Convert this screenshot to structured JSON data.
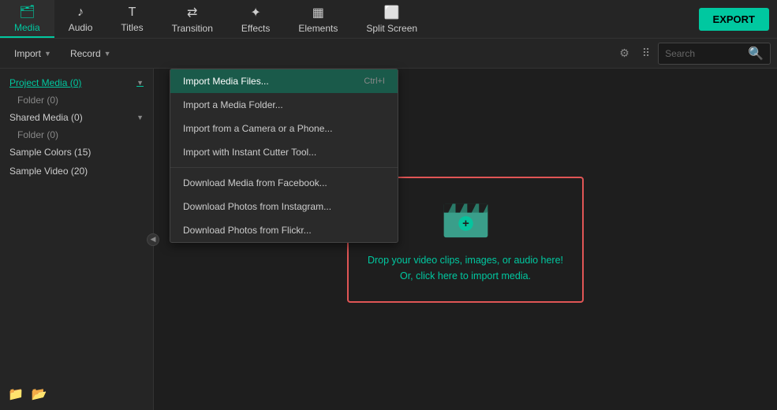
{
  "nav": {
    "items": [
      {
        "id": "media",
        "label": "Media",
        "icon": "🗂",
        "active": true
      },
      {
        "id": "audio",
        "label": "Audio",
        "icon": "♪"
      },
      {
        "id": "titles",
        "label": "Titles",
        "icon": "T"
      },
      {
        "id": "transition",
        "label": "Transition",
        "icon": "⇄"
      },
      {
        "id": "effects",
        "label": "Effects",
        "icon": "✦"
      },
      {
        "id": "elements",
        "label": "Elements",
        "icon": "▦"
      },
      {
        "id": "splitscreen",
        "label": "Split Screen",
        "icon": "⬜"
      }
    ],
    "export_label": "EXPORT"
  },
  "secondary_bar": {
    "import_label": "Import",
    "record_label": "Record",
    "search_placeholder": "Search"
  },
  "sidebar": {
    "items": [
      {
        "id": "project-media",
        "label": "Project Media (0)",
        "active": true
      },
      {
        "id": "folder-0",
        "label": "Folder (0)",
        "sub": true
      },
      {
        "id": "shared-media",
        "label": "Shared Media (0)"
      },
      {
        "id": "folder-0b",
        "label": "Folder (0)",
        "sub": true
      },
      {
        "id": "sample-colors",
        "label": "Sample Colors (15)"
      },
      {
        "id": "sample-video",
        "label": "Sample Video (20)"
      }
    ],
    "bottom_icons": [
      "new-folder-icon",
      "new-smart-folder-icon"
    ]
  },
  "dropdown": {
    "items": [
      {
        "id": "import-files",
        "label": "Import Media Files...",
        "shortcut": "Ctrl+I",
        "highlighted": true
      },
      {
        "id": "import-folder",
        "label": "Import a Media Folder..."
      },
      {
        "id": "import-camera",
        "label": "Import from a Camera or a Phone..."
      },
      {
        "id": "import-cutter",
        "label": "Import with Instant Cutter Tool..."
      },
      {
        "id": "separator1",
        "separator": true
      },
      {
        "id": "facebook",
        "label": "Download Media from Facebook..."
      },
      {
        "id": "instagram",
        "label": "Download Photos from Instagram..."
      },
      {
        "id": "flickr",
        "label": "Download Photos from Flickr..."
      }
    ]
  },
  "drop_zone": {
    "line1": "Drop your video clips, images, or audio here!",
    "line2": "Or, click here to import media."
  }
}
